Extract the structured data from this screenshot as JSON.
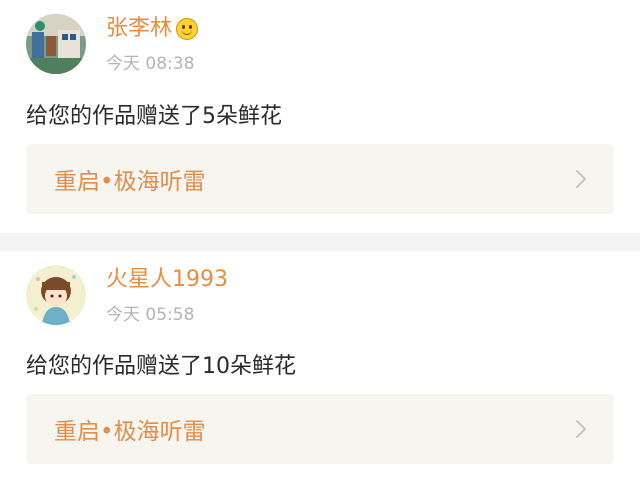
{
  "items": [
    {
      "username": "张李林",
      "has_emoji": true,
      "time": "今天 08:38",
      "message": "给您的作品赠送了5朵鲜花",
      "work_title": "重启•极海听雷"
    },
    {
      "username": "火星人1993",
      "has_emoji": false,
      "time": "今天 05:58",
      "message": "给您的作品赠送了10朵鲜花",
      "work_title": "重启•极海听雷"
    }
  ],
  "icons": {
    "chevron": "chevron-right-icon",
    "emoji": "smiley-emoji-icon"
  },
  "colors": {
    "username": "#ea8c3d",
    "work_title": "#e38d4b",
    "time": "#b4b4b4",
    "link_bg": "#f6f5f0",
    "separator": "#f4f4f4"
  }
}
